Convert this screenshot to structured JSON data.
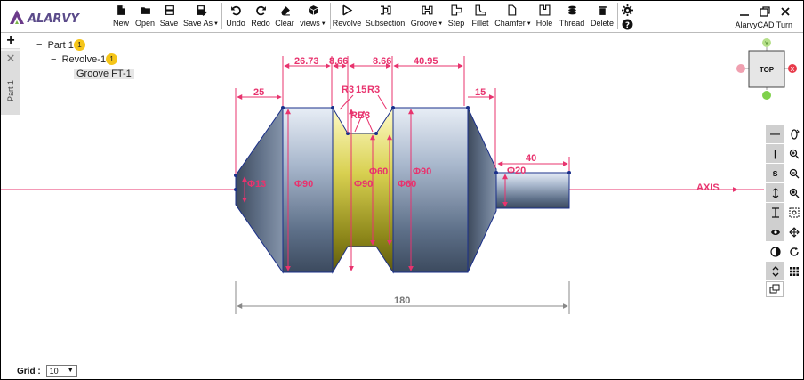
{
  "app": {
    "logo_text": "ALARVY",
    "brand": "AlarvyCAD Turn"
  },
  "toolbar": {
    "new": "New",
    "open": "Open",
    "save": "Save",
    "save_as": "Save As",
    "undo": "Undo",
    "redo": "Redo",
    "clear": "Clear",
    "views": "views",
    "revolve": "Revolve",
    "subsection": "Subsection",
    "groove": "Groove",
    "step": "Step",
    "fillet": "Fillet",
    "chamfer": "Chamfer",
    "hole": "Hole",
    "thread": "Thread",
    "delete": "Delete"
  },
  "sidebar": {
    "add": "+",
    "close": "✕",
    "tab_label": "Part 1"
  },
  "tree": {
    "part": "Part 1",
    "part_badge": "1",
    "revolve": "Revolve-1",
    "revolve_badge": "1",
    "groove": "Groove FT-1"
  },
  "drawing": {
    "dims": {
      "d26_73": "26.73",
      "d8_66a": "8.66",
      "d8_66b": "8.66",
      "d40_95": "40.95",
      "d25": "25",
      "d15": "15",
      "d40": "40",
      "d180": "180",
      "r3_left": "R3",
      "r15": "15",
      "r3_right": "R3",
      "rb": "RB",
      "r3_lower": "3",
      "phi13": "Φ13",
      "phi90_left": "Φ90",
      "phi90_mid": "Φ90",
      "phi60_a": "Φ60",
      "phi90_right": "Φ90",
      "phi60_b": "Φ60",
      "phi20": "Φ20"
    },
    "axis_label": "AXIS",
    "colors": {
      "dim": "#e8336e",
      "outline": "#1a2f8a",
      "groove": "#c9c02a",
      "steel": "#8e9fb8"
    }
  },
  "viewcube": {
    "face": "TOP",
    "y_label": "Y",
    "x_label": "X"
  },
  "view_tools": {
    "minus": "—",
    "pipe": "|",
    "s": "s"
  },
  "grid": {
    "label": "Grid :",
    "value": "10"
  }
}
